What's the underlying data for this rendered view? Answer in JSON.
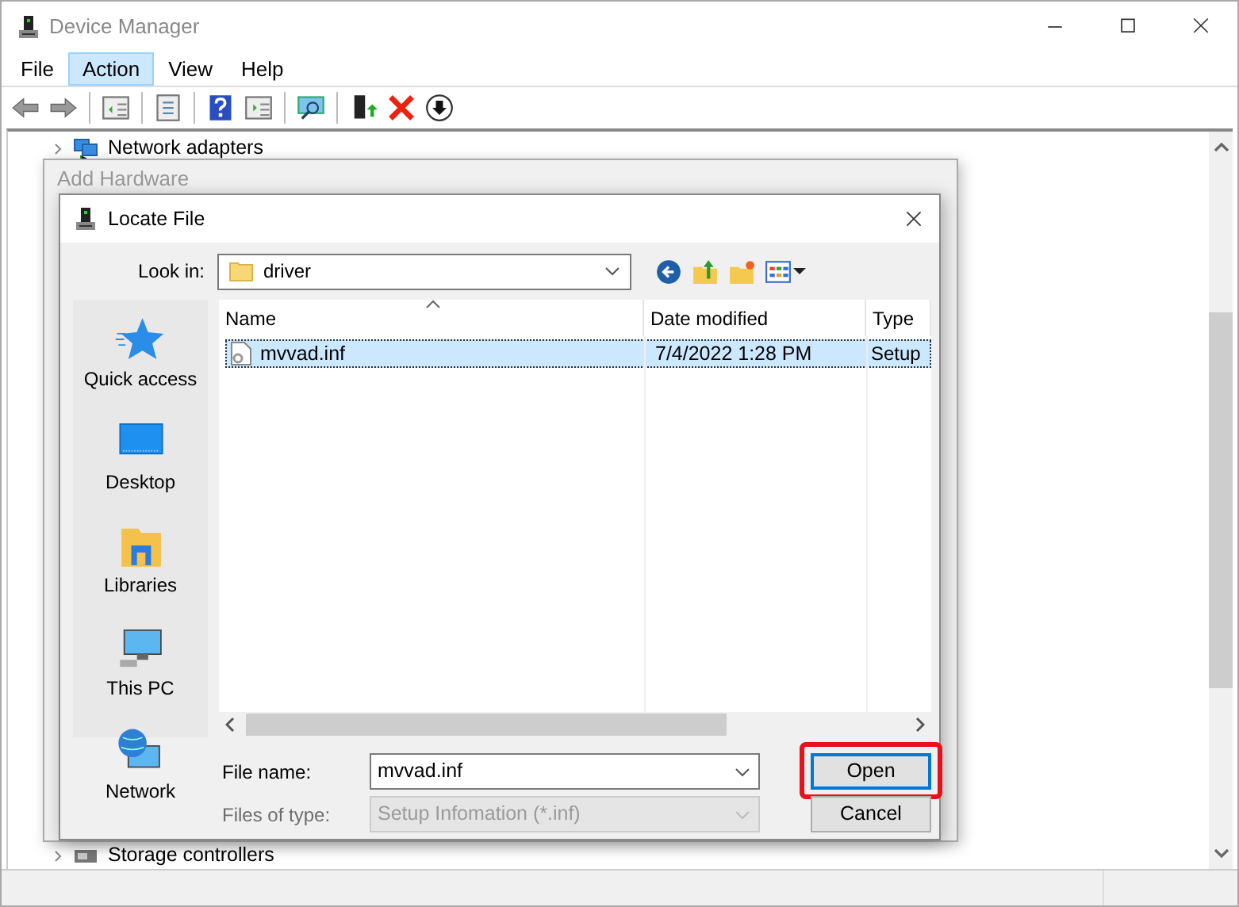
{
  "window": {
    "title": "Device Manager"
  },
  "menu": [
    {
      "label": "File",
      "selected": false
    },
    {
      "label": "Action",
      "selected": true
    },
    {
      "label": "View",
      "selected": false
    },
    {
      "label": "Help",
      "selected": false
    }
  ],
  "tree": [
    {
      "label": "Network adapters",
      "expanded": false
    },
    {
      "label": "Storage controllers",
      "expanded": false
    }
  ],
  "background_dialog": {
    "title": "Add Hardware"
  },
  "dialog": {
    "title": "Locate File",
    "look_in": {
      "label": "Look in:",
      "value": "driver"
    },
    "places": [
      {
        "label": "Quick access",
        "kind": "star"
      },
      {
        "label": "Desktop",
        "kind": "desktop"
      },
      {
        "label": "Libraries",
        "kind": "libraries"
      },
      {
        "label": "This PC",
        "kind": "pc"
      },
      {
        "label": "Network",
        "kind": "network"
      }
    ],
    "columns": [
      {
        "label": "Name",
        "sorted": true
      },
      {
        "label": "Date modified",
        "sorted": false
      },
      {
        "label": "Type",
        "sorted": false
      }
    ],
    "rows": [
      {
        "name": "mvvad.inf",
        "date": "7/4/2022 1:28 PM",
        "type": "Setup",
        "selected": true
      }
    ],
    "file_name": {
      "label": "File name:",
      "value": "mvvad.inf"
    },
    "file_type": {
      "label": "Files of type:",
      "value": "Setup Infomation (*.inf)",
      "disabled": true
    },
    "buttons": [
      {
        "label": "Open",
        "highlighted": true
      },
      {
        "label": "Cancel",
        "highlighted": false
      }
    ]
  }
}
